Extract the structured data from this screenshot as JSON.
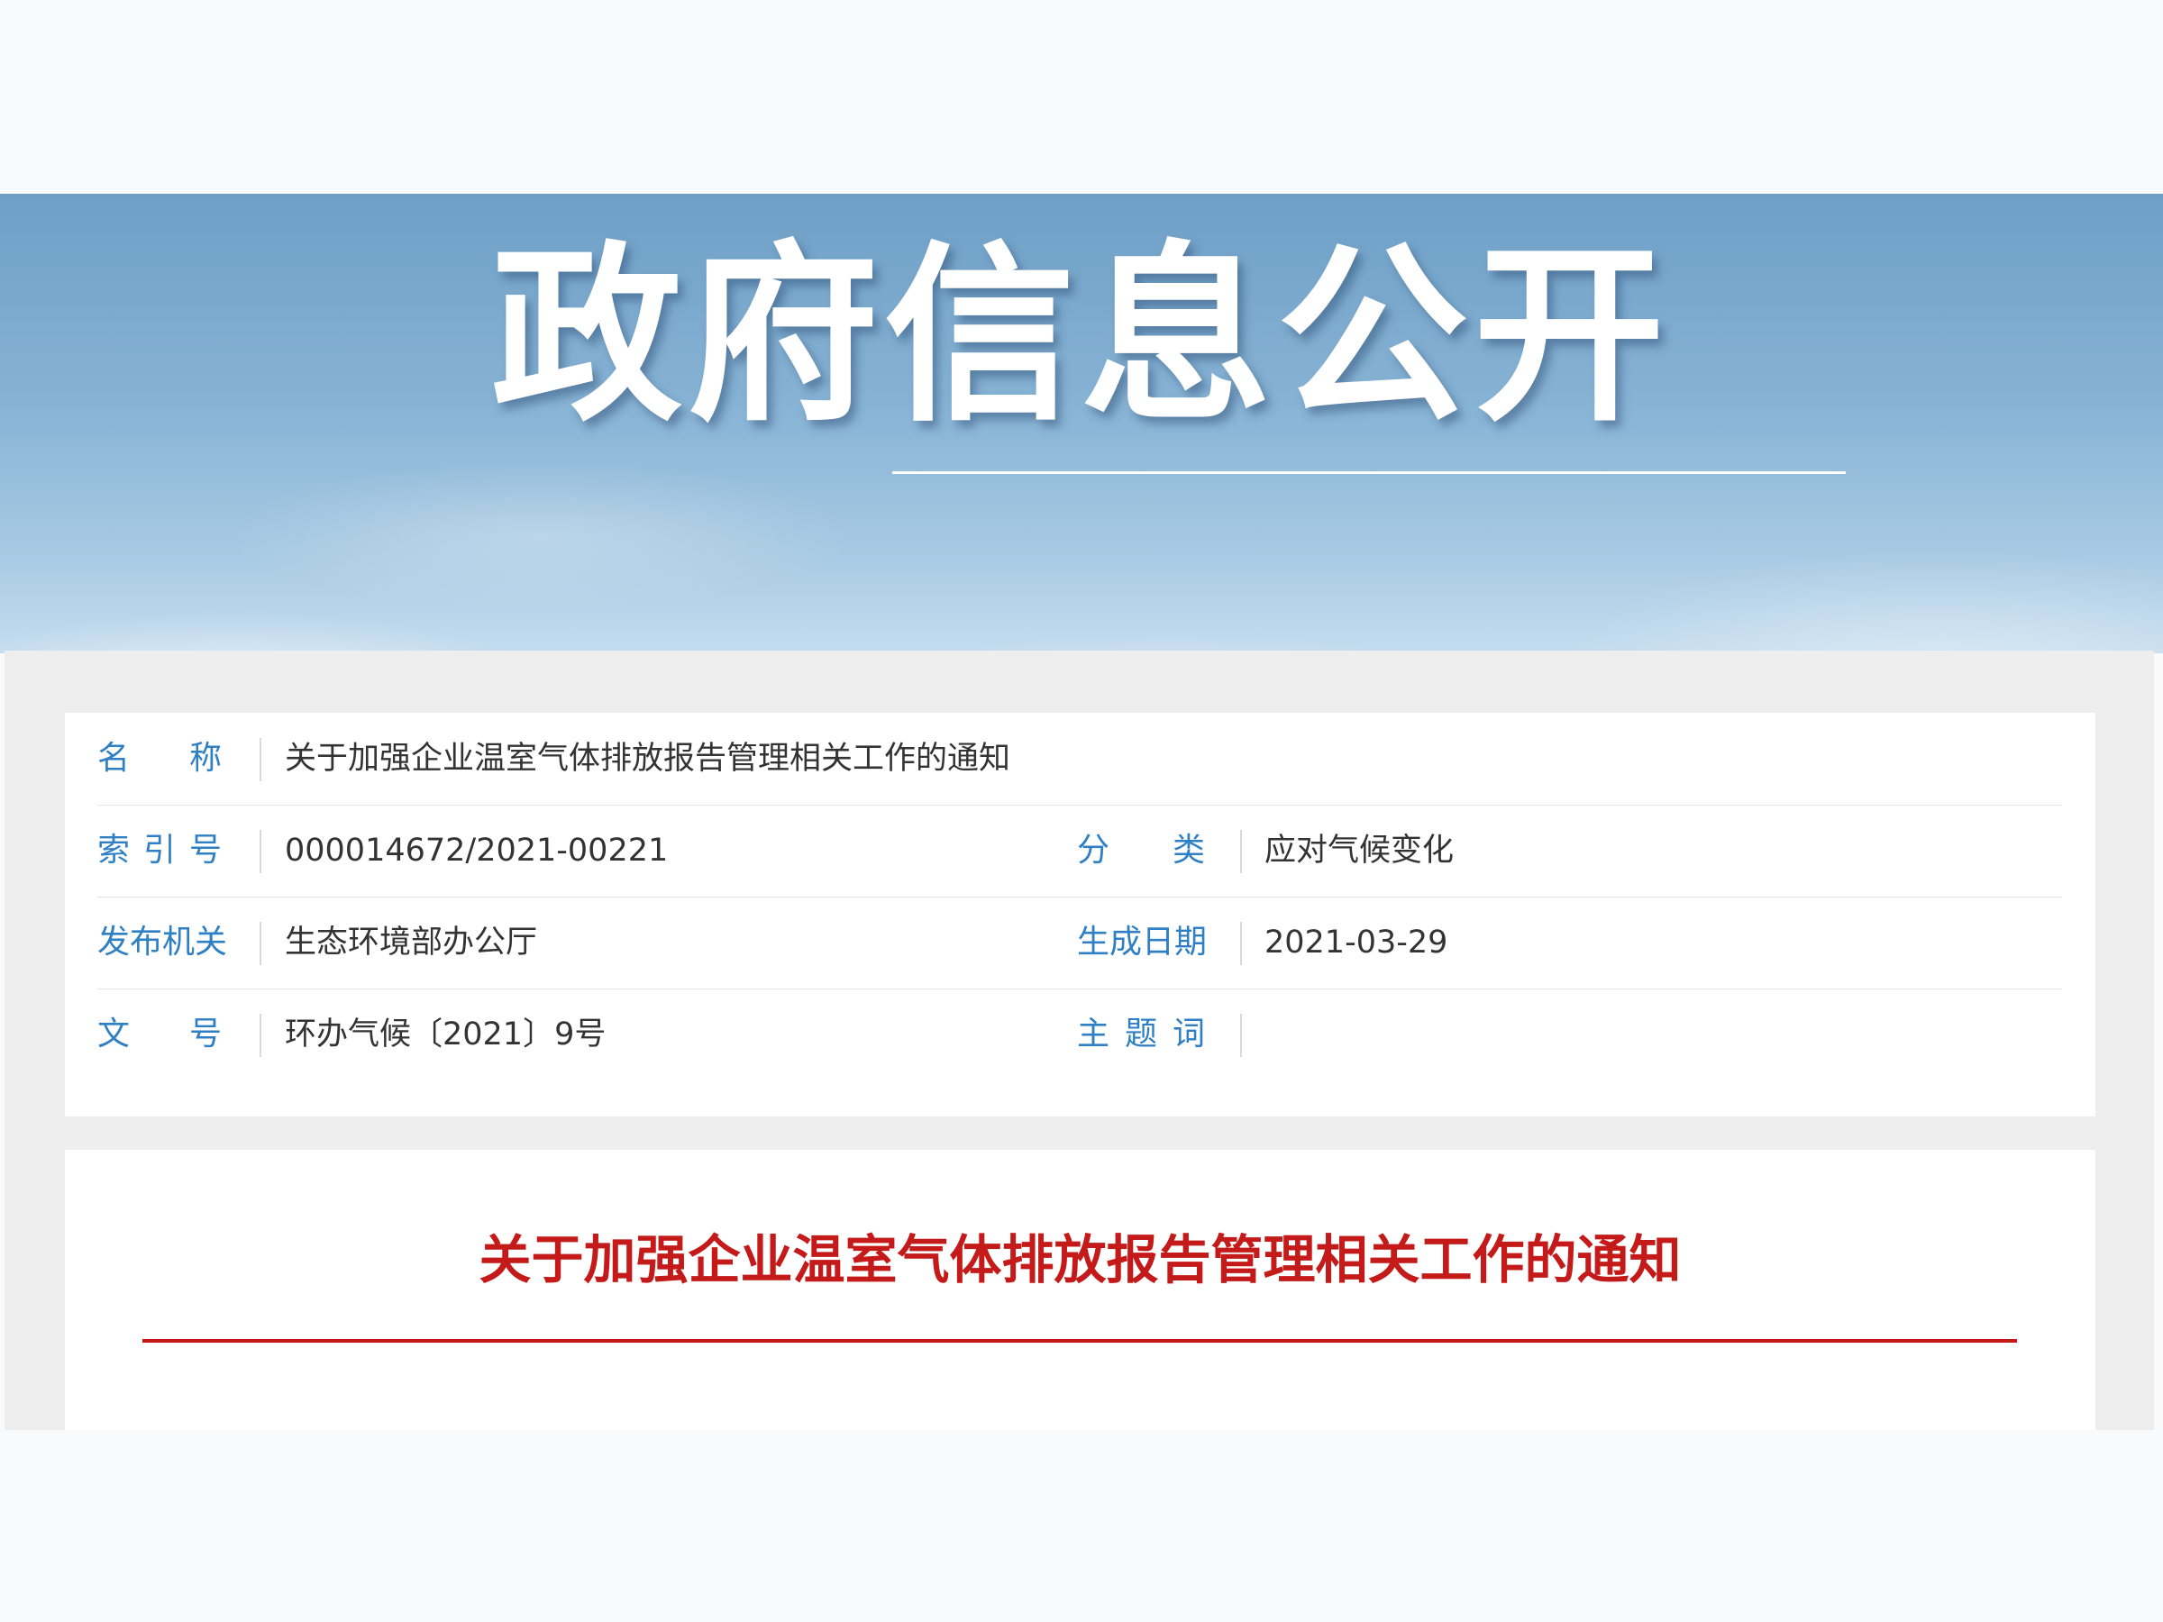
{
  "banner": {
    "title": "政府信息公开"
  },
  "metadata": {
    "name_label": "名称",
    "name_value": "关于加强企业温室气体排放报告管理相关工作的通知",
    "index_label": "索引号",
    "index_value": "000014672/2021-00221",
    "category_label": "分类",
    "category_value": "应对气候变化",
    "publisher_label": "发布机关",
    "publisher_value": "生态环境部办公厅",
    "date_label": "生成日期",
    "date_value": "2021-03-29",
    "doc_number_label": "文号",
    "doc_number_value": "环办气候〔2021〕9号",
    "keywords_label": "主题词",
    "keywords_value": ""
  },
  "document": {
    "title": "关于加强企业温室气体排放报告管理相关工作的通知"
  },
  "colors": {
    "label_blue": "#2f7fc4",
    "title_red": "#c41a1a",
    "banner_sky": "#86b2d4"
  }
}
